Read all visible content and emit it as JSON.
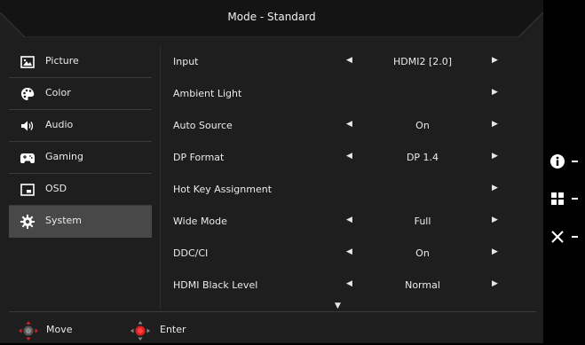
{
  "header": {
    "title": "Mode - Standard"
  },
  "sidebar": {
    "items": [
      {
        "label": "Picture",
        "icon": "picture-icon"
      },
      {
        "label": "Color",
        "icon": "palette-icon"
      },
      {
        "label": "Audio",
        "icon": "speaker-icon"
      },
      {
        "label": "Gaming",
        "icon": "gamepad-icon"
      },
      {
        "label": "OSD",
        "icon": "osd-window-icon"
      },
      {
        "label": "System",
        "icon": "gear-icon",
        "active": true
      }
    ]
  },
  "settings": {
    "rows": [
      {
        "name": "Input",
        "value": "HDMI2 [2.0]"
      },
      {
        "name": "Ambient Light",
        "value": ""
      },
      {
        "name": "Auto Source",
        "value": "On"
      },
      {
        "name": "DP Format",
        "value": "DP 1.4"
      },
      {
        "name": "Hot Key Assignment",
        "value": ""
      },
      {
        "name": "Wide Mode",
        "value": "Full"
      },
      {
        "name": "DDC/CI",
        "value": "On"
      },
      {
        "name": "HDMI Black Level",
        "value": "Normal"
      }
    ]
  },
  "footer": {
    "move_label": "Move",
    "enter_label": "Enter"
  },
  "hotkeys": [
    {
      "icon": "info-icon"
    },
    {
      "icon": "menu-grid-icon"
    },
    {
      "icon": "close-icon"
    }
  ],
  "colors": {
    "panel": "#1e1e1e",
    "active_item": "#484848",
    "nav_accent": "#e02020"
  }
}
